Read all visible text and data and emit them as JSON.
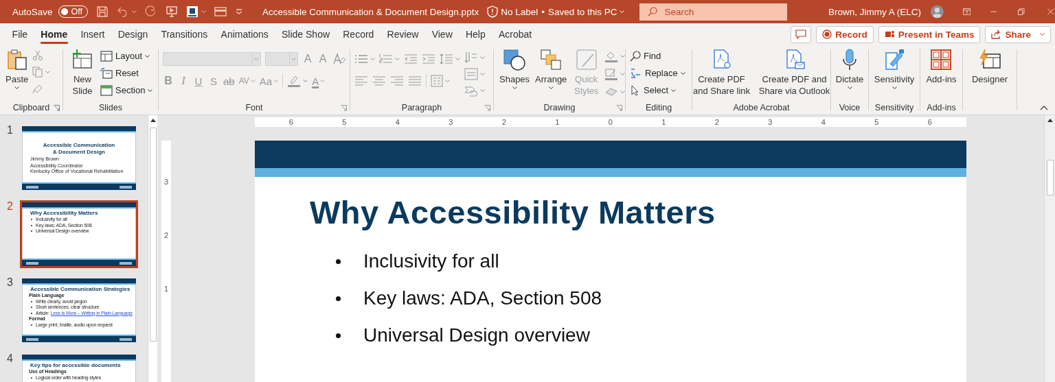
{
  "title_bar": {
    "autosave_label": "AutoSave",
    "autosave": {
      "label": "Off",
      "on": false
    },
    "file_name": "Accessible Communication & Document Design.pptx",
    "sensitivity_label": "No Label",
    "separator": "•",
    "save_status": "Saved to this PC",
    "search": {
      "placeholder": "Search"
    },
    "user_name": "Brown, Jimmy A (ELC)"
  },
  "menu_tabs": [
    {
      "label": "File",
      "selected": false
    },
    {
      "label": "Home",
      "selected": true
    },
    {
      "label": "Insert",
      "selected": false
    },
    {
      "label": "Design",
      "selected": false
    },
    {
      "label": "Transitions",
      "selected": false
    },
    {
      "label": "Animations",
      "selected": false
    },
    {
      "label": "Slide Show",
      "selected": false
    },
    {
      "label": "Record",
      "selected": false
    },
    {
      "label": "Review",
      "selected": false
    },
    {
      "label": "View",
      "selected": false
    },
    {
      "label": "Help",
      "selected": false
    },
    {
      "label": "Acrobat",
      "selected": false
    }
  ],
  "actions": [
    "Record",
    "Present in Teams",
    "Share"
  ],
  "ribbon": [
    {
      "title": "Clipboard",
      "controls": [
        {
          "label": "Paste"
        }
      ]
    },
    {
      "title": "Slides",
      "controls": [
        {
          "label": "New Slide"
        },
        {
          "label": "Layout"
        },
        {
          "label": "Reset"
        },
        {
          "label": "Section"
        }
      ]
    },
    {
      "title": "Font",
      "controls": [
        {
          "label": "A",
          "disabled": true
        },
        {
          "label": "A",
          "disabled": true
        },
        {
          "label": "B",
          "disabled": true
        },
        {
          "label": "I",
          "disabled": true
        },
        {
          "label": "U",
          "disabled": true
        },
        {
          "label": "S",
          "disabled": true
        },
        {
          "label": "ab",
          "disabled": true
        },
        {
          "label": "AV",
          "disabled": true
        },
        {
          "label": "Aa",
          "disabled": true
        },
        {
          "label": "A",
          "disabled": true
        }
      ]
    },
    {
      "title": "Paragraph"
    },
    {
      "title": "Drawing",
      "controls": [
        {
          "label": "Shapes",
          "disabled": false
        },
        {
          "label": "Arrange",
          "disabled": false
        },
        {
          "label": "Quick Styles",
          "disabled": true
        }
      ]
    },
    {
      "title": "Editing",
      "controls": [
        {
          "label": "Find"
        },
        {
          "label": "Replace"
        },
        {
          "label": "Select"
        }
      ]
    },
    {
      "title": "Adobe Acrobat",
      "controls": [
        {
          "label": "Create PDF and Share link"
        },
        {
          "label": "Create PDF and Share via Outlook"
        }
      ]
    },
    {
      "title": "Voice",
      "controls": [
        {
          "label": "Dictate"
        }
      ]
    },
    {
      "title": "Sensitivity",
      "controls": [
        {
          "label": "Sensitivity"
        }
      ]
    },
    {
      "title": "Add-ins",
      "controls": [
        {
          "label": "Add-ins"
        }
      ]
    },
    {
      "controls": [
        {
          "label": "Designer"
        }
      ]
    }
  ],
  "thumbnails": [
    {
      "number": "1",
      "selected": false,
      "kind": "title_slide",
      "title": "Accessible Communication & Document Design",
      "lines": [
        {
          "kind": "plain",
          "text": "Jimmy Brown"
        },
        {
          "kind": "plain",
          "text": "Accessibility Coordinator"
        },
        {
          "kind": "plain",
          "text": "Kentucky Office of Vocational Rehabilitation"
        }
      ]
    },
    {
      "number": "2",
      "selected": true,
      "kind": "content",
      "title": "Why Accessibility Matters",
      "lines": [
        {
          "kind": "bullet",
          "text": "Inclusivity for all"
        },
        {
          "kind": "bullet",
          "text": "Key laws: ADA, Section 508"
        },
        {
          "kind": "bullet",
          "text": "Universal Design overview"
        }
      ]
    },
    {
      "number": "3",
      "selected": false,
      "kind": "content",
      "title": "Accessible Communication Strategies",
      "lines": [
        {
          "kind": "heading",
          "text": "Plain Language"
        },
        {
          "kind": "bullet",
          "text": "Write clearly, avoid jargon"
        },
        {
          "kind": "bullet",
          "text": "Short sentences, clear structure"
        },
        {
          "kind": "bullet",
          "text": "Article:",
          "link": "Less is More – Writing in Plain Language"
        },
        {
          "kind": "heading",
          "text": "Format"
        },
        {
          "kind": "bullet",
          "text": "Large print, braille, audio upon request"
        }
      ]
    },
    {
      "number": "4",
      "selected": false,
      "kind": "content",
      "title": "Key tips for accessible documents",
      "lines": [
        {
          "kind": "heading",
          "text": "Use of Headings"
        },
        {
          "kind": "bullet",
          "text": "Logical order with heading styles"
        }
      ]
    }
  ],
  "ruler": {
    "horizontal": [
      "6",
      "5",
      "4",
      "3",
      "2",
      "1",
      "0",
      "1",
      "2",
      "3",
      "4",
      "5",
      "6"
    ],
    "vertical": [
      "3",
      "2",
      "1"
    ]
  },
  "slide": {
    "title": "Why Accessibility Matters",
    "bullets": [
      "Inclusivity for all",
      "Key laws: ADA, Section 508",
      "Universal Design overview"
    ]
  }
}
